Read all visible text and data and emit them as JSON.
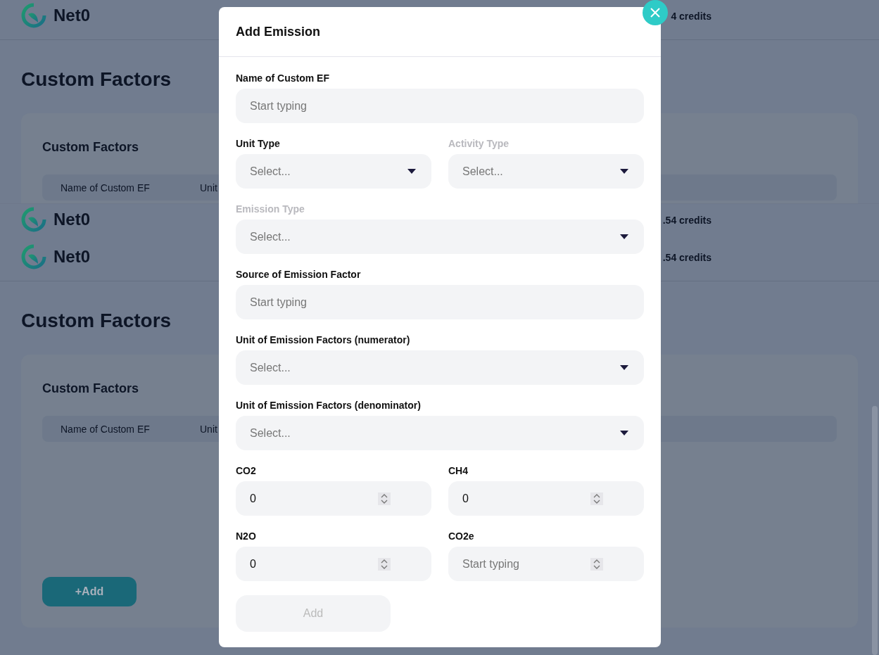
{
  "background": [
    {
      "kind": "header",
      "brand": "Net0",
      "credits": "4 credits",
      "border": true
    },
    {
      "kind": "section",
      "truncated": true,
      "title": "Custom Factors",
      "card_title": "Custom Factors",
      "columns": [
        "Name of Custom EF",
        "Unit"
      ]
    },
    {
      "kind": "header",
      "brand": "Net0",
      "credits": ".54 credits",
      "border": false
    },
    {
      "kind": "header",
      "brand": "Net0",
      "credits": ".54 credits",
      "border": true
    },
    {
      "kind": "section",
      "truncated": false,
      "title": "Custom Factors",
      "card_title": "Custom Factors",
      "columns": [
        "Name of Custom EF",
        "Unit"
      ],
      "add_button": "+Add"
    }
  ],
  "dialog": {
    "title": "Add Emission",
    "rows": [
      [
        {
          "kind": "text",
          "label": "Name of Custom EF",
          "disabled": false,
          "placeholder": "Start typing"
        }
      ],
      [
        {
          "kind": "select",
          "label": "Unit Type",
          "disabled": false,
          "placeholder": "Select..."
        },
        {
          "kind": "select",
          "label": "Activity Type",
          "disabled": true,
          "placeholder": "Select..."
        }
      ],
      [
        {
          "kind": "select",
          "label": "Emission Type",
          "disabled": true,
          "placeholder": "Select..."
        }
      ],
      [
        {
          "kind": "text",
          "label": "Source of Emission Factor",
          "disabled": false,
          "placeholder": "Start typing"
        }
      ],
      [
        {
          "kind": "select",
          "label": "Unit of Emission Factors (numerator)",
          "disabled": false,
          "placeholder": "Select..."
        }
      ],
      [
        {
          "kind": "select",
          "label": "Unit of Emission Factors (denominator)",
          "disabled": false,
          "placeholder": "Select..."
        }
      ],
      [
        {
          "kind": "number",
          "label": "CO2",
          "disabled": false,
          "value": "0"
        },
        {
          "kind": "number",
          "label": "CH4",
          "disabled": false,
          "value": "0"
        }
      ],
      [
        {
          "kind": "number",
          "label": "N2O",
          "disabled": false,
          "value": "0"
        },
        {
          "kind": "number",
          "label": "CO2e",
          "disabled": false,
          "placeholder": "Start typing"
        }
      ]
    ],
    "submit": {
      "label": "Add",
      "disabled": true
    }
  }
}
